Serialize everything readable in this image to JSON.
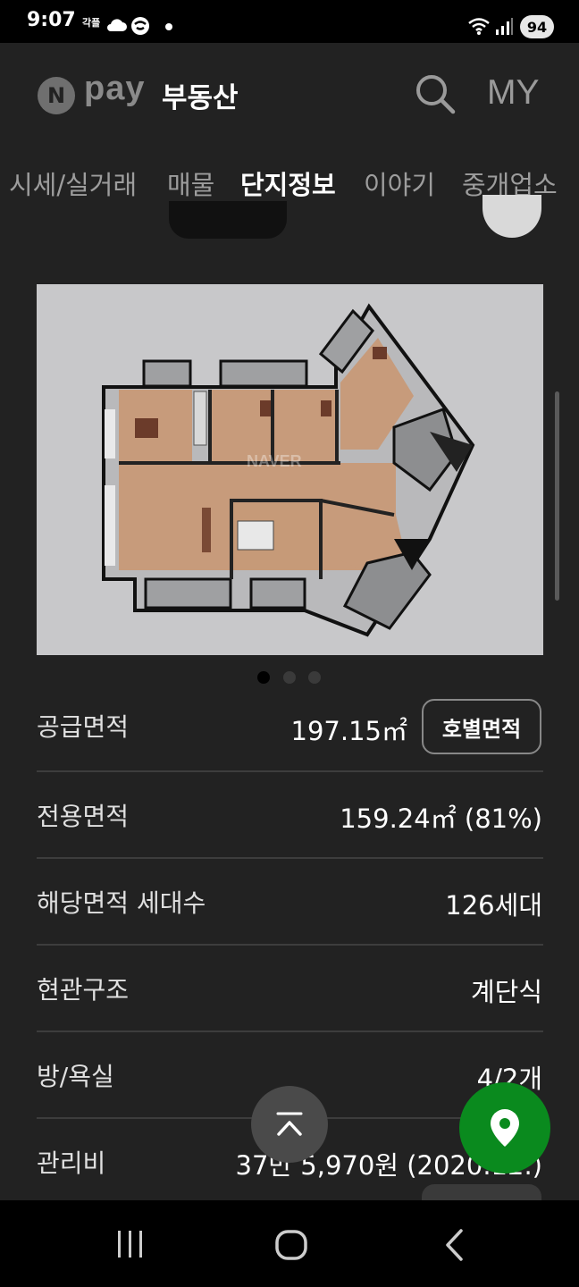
{
  "status_bar": {
    "time": "9:07",
    "carrier_label": "각플",
    "battery": "94",
    "icons": [
      "cloud-icon",
      "app-notification-icon",
      "dot-icon",
      "wifi-icon",
      "signal-icon",
      "battery-icon"
    ]
  },
  "header": {
    "logo_letter": "N",
    "brand_pay": "pay",
    "brand_name": "부동산",
    "search_icon": "search-icon",
    "my_label": "MY"
  },
  "tabs": [
    {
      "label": "시세/실거래"
    },
    {
      "label": "매물"
    },
    {
      "label": "단지정보",
      "active": true
    },
    {
      "label": "이야기"
    },
    {
      "label": "중개업소"
    }
  ],
  "floor_plan": {
    "watermark": "NAVER",
    "slide_count": 3,
    "active_slide": 1
  },
  "info": {
    "supply_area": {
      "label": "공급면적",
      "value": "197.15㎡",
      "button": "호별면적"
    },
    "exclusive_area": {
      "label": "전용면적",
      "value": "159.24㎡ (81%)"
    },
    "households": {
      "label": "해당면적 세대수",
      "value": "126세대"
    },
    "entrance": {
      "label": "현관구조",
      "value": "계단식"
    },
    "rooms": {
      "label": "방/욕실",
      "value": "4/2개"
    },
    "maintenance": {
      "label": "관리비",
      "value": "37만 5,970원 (2020.12.)"
    }
  },
  "colors": {
    "background": "#222222",
    "map_fab": "#0a8a1e",
    "active_tab": "#ffffff",
    "inactive_tab": "#9d9d9d"
  }
}
